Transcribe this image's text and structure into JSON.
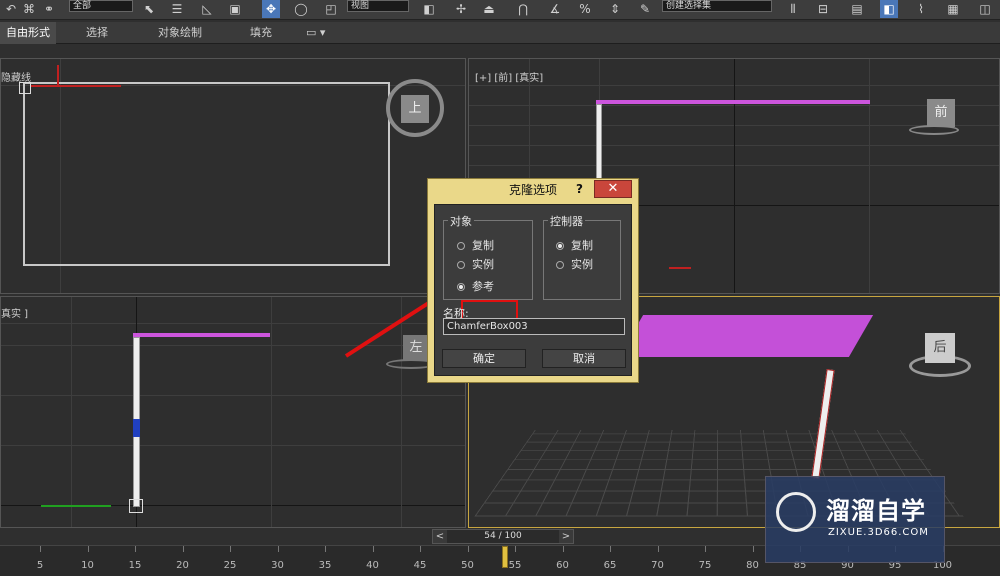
{
  "toolbar": {
    "selection_filter": "全部",
    "ref_coord": "视图",
    "named_selection": "创建选择集"
  },
  "ribbon": {
    "tabs": [
      "自由形式",
      "选择",
      "对象绘制",
      "填充"
    ]
  },
  "viewports": {
    "top_left_label": "隐藏线",
    "top_right_label": "[+] [前] [真实]",
    "bottom_left_label": "真实 ]",
    "viewcube_top": "上",
    "viewcube_front": "前",
    "viewcube_left": "左",
    "viewcube_persp": "后"
  },
  "dialog": {
    "title": "克隆选项",
    "help": "?",
    "close": "✕",
    "object_group": "对象",
    "object_options": [
      "复制",
      "实例",
      "参考"
    ],
    "object_selected": 2,
    "controller_group": "控制器",
    "controller_options": [
      "复制",
      "实例"
    ],
    "controller_selected": 0,
    "name_label": "名称:",
    "name_value": "ChamferBox003",
    "ok": "确定",
    "cancel": "取消"
  },
  "timeline": {
    "frame_text": "54 / 100",
    "prev": "<",
    "next": ">",
    "ticks": [
      "5",
      "10",
      "15",
      "20",
      "25",
      "30",
      "35",
      "40",
      "45",
      "50",
      "55",
      "60",
      "65",
      "70",
      "75",
      "80",
      "85",
      "90",
      "95",
      "100"
    ]
  },
  "watermark": {
    "title": "溜溜自学",
    "subtitle": "ZIXUE.3D66.COM"
  }
}
